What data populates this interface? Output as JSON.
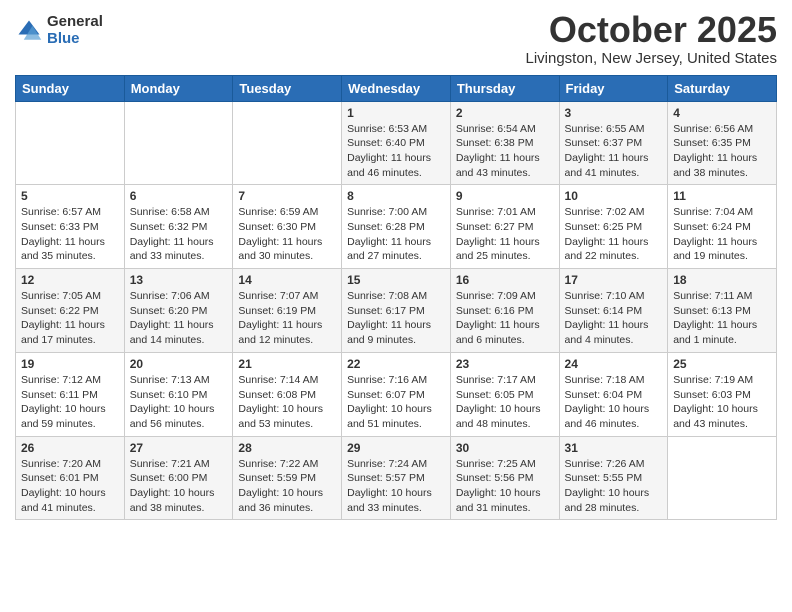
{
  "header": {
    "logo_general": "General",
    "logo_blue": "Blue",
    "month_title": "October 2025",
    "location": "Livingston, New Jersey, United States"
  },
  "weekdays": [
    "Sunday",
    "Monday",
    "Tuesday",
    "Wednesday",
    "Thursday",
    "Friday",
    "Saturday"
  ],
  "weeks": [
    [
      {
        "day": "",
        "info": ""
      },
      {
        "day": "",
        "info": ""
      },
      {
        "day": "",
        "info": ""
      },
      {
        "day": "1",
        "info": "Sunrise: 6:53 AM\nSunset: 6:40 PM\nDaylight: 11 hours\nand 46 minutes."
      },
      {
        "day": "2",
        "info": "Sunrise: 6:54 AM\nSunset: 6:38 PM\nDaylight: 11 hours\nand 43 minutes."
      },
      {
        "day": "3",
        "info": "Sunrise: 6:55 AM\nSunset: 6:37 PM\nDaylight: 11 hours\nand 41 minutes."
      },
      {
        "day": "4",
        "info": "Sunrise: 6:56 AM\nSunset: 6:35 PM\nDaylight: 11 hours\nand 38 minutes."
      }
    ],
    [
      {
        "day": "5",
        "info": "Sunrise: 6:57 AM\nSunset: 6:33 PM\nDaylight: 11 hours\nand 35 minutes."
      },
      {
        "day": "6",
        "info": "Sunrise: 6:58 AM\nSunset: 6:32 PM\nDaylight: 11 hours\nand 33 minutes."
      },
      {
        "day": "7",
        "info": "Sunrise: 6:59 AM\nSunset: 6:30 PM\nDaylight: 11 hours\nand 30 minutes."
      },
      {
        "day": "8",
        "info": "Sunrise: 7:00 AM\nSunset: 6:28 PM\nDaylight: 11 hours\nand 27 minutes."
      },
      {
        "day": "9",
        "info": "Sunrise: 7:01 AM\nSunset: 6:27 PM\nDaylight: 11 hours\nand 25 minutes."
      },
      {
        "day": "10",
        "info": "Sunrise: 7:02 AM\nSunset: 6:25 PM\nDaylight: 11 hours\nand 22 minutes."
      },
      {
        "day": "11",
        "info": "Sunrise: 7:04 AM\nSunset: 6:24 PM\nDaylight: 11 hours\nand 19 minutes."
      }
    ],
    [
      {
        "day": "12",
        "info": "Sunrise: 7:05 AM\nSunset: 6:22 PM\nDaylight: 11 hours\nand 17 minutes."
      },
      {
        "day": "13",
        "info": "Sunrise: 7:06 AM\nSunset: 6:20 PM\nDaylight: 11 hours\nand 14 minutes."
      },
      {
        "day": "14",
        "info": "Sunrise: 7:07 AM\nSunset: 6:19 PM\nDaylight: 11 hours\nand 12 minutes."
      },
      {
        "day": "15",
        "info": "Sunrise: 7:08 AM\nSunset: 6:17 PM\nDaylight: 11 hours\nand 9 minutes."
      },
      {
        "day": "16",
        "info": "Sunrise: 7:09 AM\nSunset: 6:16 PM\nDaylight: 11 hours\nand 6 minutes."
      },
      {
        "day": "17",
        "info": "Sunrise: 7:10 AM\nSunset: 6:14 PM\nDaylight: 11 hours\nand 4 minutes."
      },
      {
        "day": "18",
        "info": "Sunrise: 7:11 AM\nSunset: 6:13 PM\nDaylight: 11 hours\nand 1 minute."
      }
    ],
    [
      {
        "day": "19",
        "info": "Sunrise: 7:12 AM\nSunset: 6:11 PM\nDaylight: 10 hours\nand 59 minutes."
      },
      {
        "day": "20",
        "info": "Sunrise: 7:13 AM\nSunset: 6:10 PM\nDaylight: 10 hours\nand 56 minutes."
      },
      {
        "day": "21",
        "info": "Sunrise: 7:14 AM\nSunset: 6:08 PM\nDaylight: 10 hours\nand 53 minutes."
      },
      {
        "day": "22",
        "info": "Sunrise: 7:16 AM\nSunset: 6:07 PM\nDaylight: 10 hours\nand 51 minutes."
      },
      {
        "day": "23",
        "info": "Sunrise: 7:17 AM\nSunset: 6:05 PM\nDaylight: 10 hours\nand 48 minutes."
      },
      {
        "day": "24",
        "info": "Sunrise: 7:18 AM\nSunset: 6:04 PM\nDaylight: 10 hours\nand 46 minutes."
      },
      {
        "day": "25",
        "info": "Sunrise: 7:19 AM\nSunset: 6:03 PM\nDaylight: 10 hours\nand 43 minutes."
      }
    ],
    [
      {
        "day": "26",
        "info": "Sunrise: 7:20 AM\nSunset: 6:01 PM\nDaylight: 10 hours\nand 41 minutes."
      },
      {
        "day": "27",
        "info": "Sunrise: 7:21 AM\nSunset: 6:00 PM\nDaylight: 10 hours\nand 38 minutes."
      },
      {
        "day": "28",
        "info": "Sunrise: 7:22 AM\nSunset: 5:59 PM\nDaylight: 10 hours\nand 36 minutes."
      },
      {
        "day": "29",
        "info": "Sunrise: 7:24 AM\nSunset: 5:57 PM\nDaylight: 10 hours\nand 33 minutes."
      },
      {
        "day": "30",
        "info": "Sunrise: 7:25 AM\nSunset: 5:56 PM\nDaylight: 10 hours\nand 31 minutes."
      },
      {
        "day": "31",
        "info": "Sunrise: 7:26 AM\nSunset: 5:55 PM\nDaylight: 10 hours\nand 28 minutes."
      },
      {
        "day": "",
        "info": ""
      }
    ]
  ]
}
